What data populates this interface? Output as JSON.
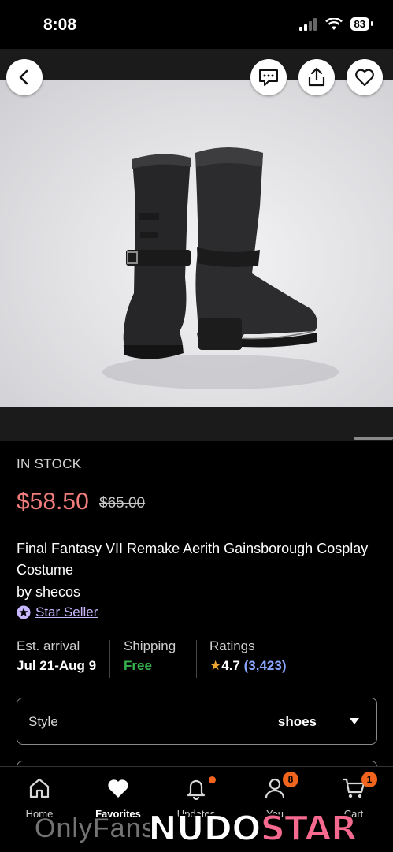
{
  "status_bar": {
    "time": "8:08",
    "battery": "83"
  },
  "product": {
    "stock_status": "IN STOCK",
    "price": "$58.50",
    "original_price": "$65.00",
    "title": "Final Fantasy VII Remake Aerith Gainsborough Cosplay Costume",
    "seller": "by shecos",
    "seller_badge": "Star Seller"
  },
  "info": {
    "arrival_label": "Est. arrival",
    "arrival_value": "Jul 21-Aug 9",
    "shipping_label": "Shipping",
    "shipping_value": "Free",
    "ratings_label": "Ratings",
    "rating_value": "4.7",
    "rating_count": "(3,423)"
  },
  "style_select": {
    "label": "Style",
    "value": "shoes"
  },
  "tabs": [
    {
      "label": "Home",
      "icon": "home-icon"
    },
    {
      "label": "Favorites",
      "icon": "heart-icon"
    },
    {
      "label": "Updates",
      "icon": "bell-icon"
    },
    {
      "label": "You",
      "icon": "person-icon",
      "badge": "8"
    },
    {
      "label": "Cart",
      "icon": "cart-icon",
      "badge": "1"
    }
  ],
  "watermark": {
    "left": "OnlyFans",
    "brand_a": "NUDO",
    "brand_b": "STAR"
  },
  "colors": {
    "price": "#f07c7c",
    "accent": "#f1641e",
    "free": "#37b24d",
    "link": "#8aa8ff"
  }
}
